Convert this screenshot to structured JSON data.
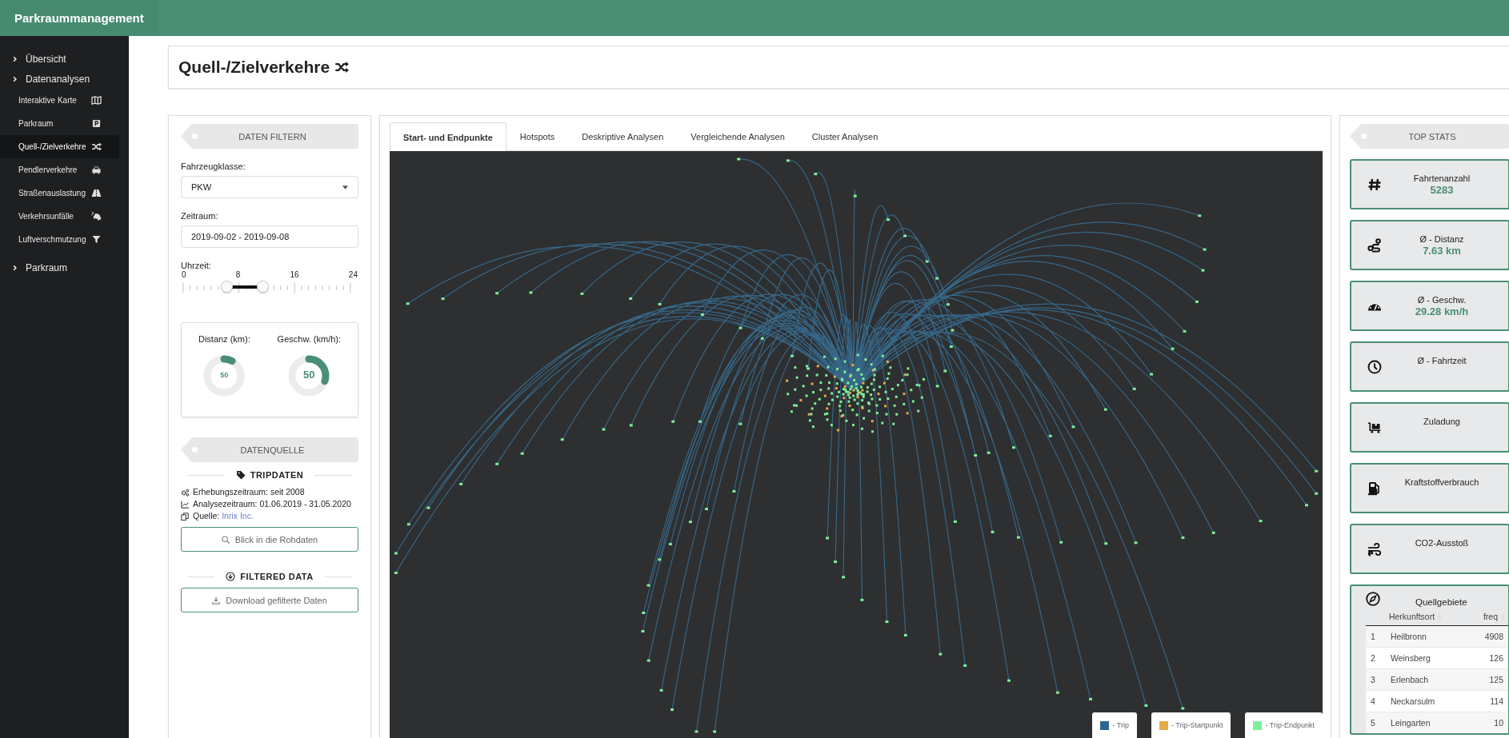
{
  "app_title": "Parkraummanagement",
  "sidebar": {
    "items": [
      {
        "label": "Übersicht"
      },
      {
        "label": "Datenanalysen",
        "children": [
          {
            "label": "Interaktive Karte",
            "selected": false
          },
          {
            "label": "Parkraum",
            "selected": false
          },
          {
            "label": "Quell-/Zielverkehre",
            "selected": true
          },
          {
            "label": "Pendlerverkehre",
            "selected": false
          },
          {
            "label": "Straßenauslastung",
            "selected": false
          },
          {
            "label": "Verkehrsunfälle",
            "selected": false
          },
          {
            "label": "Luftverschmutzung",
            "selected": false
          }
        ]
      },
      {
        "label": "Parkraum"
      }
    ]
  },
  "page_title": "Quell-/Zielverkehre",
  "filter_panel": {
    "header": "DATEN FILTERN",
    "vehicle_class": {
      "label": "Fahrzeugklasse:",
      "value": "PKW"
    },
    "period": {
      "label": "Zeitraum:",
      "value": "2019-09-02 - 2019-09-08"
    },
    "time_slider": {
      "label": "Uhrzeit:",
      "tick_labels": [
        "0",
        "8",
        "16",
        "24"
      ],
      "handles": [
        {
          "level": 0.25
        },
        {
          "level": 0.458
        }
      ]
    },
    "gauges": [
      {
        "label": "Distanz (km):",
        "value": "50",
        "level": 0.08
      },
      {
        "label": "Geschw. (km/h):",
        "value": "50",
        "level": 0.3
      }
    ]
  },
  "source_panel": {
    "header": "DATENQUELLE",
    "section": "TRIPDATEN",
    "lines": [
      {
        "text": "Erhebungszeitraum: seit 2008"
      },
      {
        "text": "Analysezeitraum: 01.06.2019 - 31.05.2020"
      },
      {
        "text": "Quelle: ",
        "link": "Inrix Inc."
      }
    ],
    "raw_button": "Blick in die Rohdaten",
    "download_section": "FILTERED DATA",
    "download_button": "Download gefilterte Daten"
  },
  "tabs": [
    {
      "label": "Start- und Endpunkte",
      "selected": true
    },
    {
      "label": "Hotspots",
      "selected": false
    },
    {
      "label": "Deskriptive Analysen",
      "selected": false
    },
    {
      "label": "Vergleichende Analysen",
      "selected": false
    },
    {
      "label": "Cluster Analysen",
      "selected": false
    }
  ],
  "map_legend": [
    {
      "label": "- Trip",
      "color": "#2f6690"
    },
    {
      "label": "- Trip-Startpunkt",
      "color": "#e8a94a"
    },
    {
      "label": "- Trip-Endpunkt",
      "color": "#7cf29a"
    }
  ],
  "stats_panel": {
    "header": "TOP STATS",
    "cards": [
      {
        "label": "Fahrtenanzahl",
        "value": "5283"
      },
      {
        "label": "Ø - Distanz",
        "value": "7.63 km"
      },
      {
        "label": "Ø - Geschw.",
        "value": "29.28 km/h"
      },
      {
        "label": "Ø - Fahrtzeit"
      },
      {
        "label": "Zuladung"
      },
      {
        "label": "Kraftstoffverbrauch"
      },
      {
        "label": "CO2-Ausstoß"
      }
    ],
    "origins": {
      "title": "Quellgebiete",
      "columns": [
        "",
        "Herkunftsort",
        "freq"
      ],
      "rows": [
        [
          "1",
          "Heilbronn",
          "4908"
        ],
        [
          "2",
          "Weinsberg",
          "126"
        ],
        [
          "3",
          "Erlenbach",
          "125"
        ],
        [
          "4",
          "Neckarsulm",
          "114"
        ],
        [
          "5",
          "Leingarten",
          "10"
        ]
      ]
    }
  }
}
